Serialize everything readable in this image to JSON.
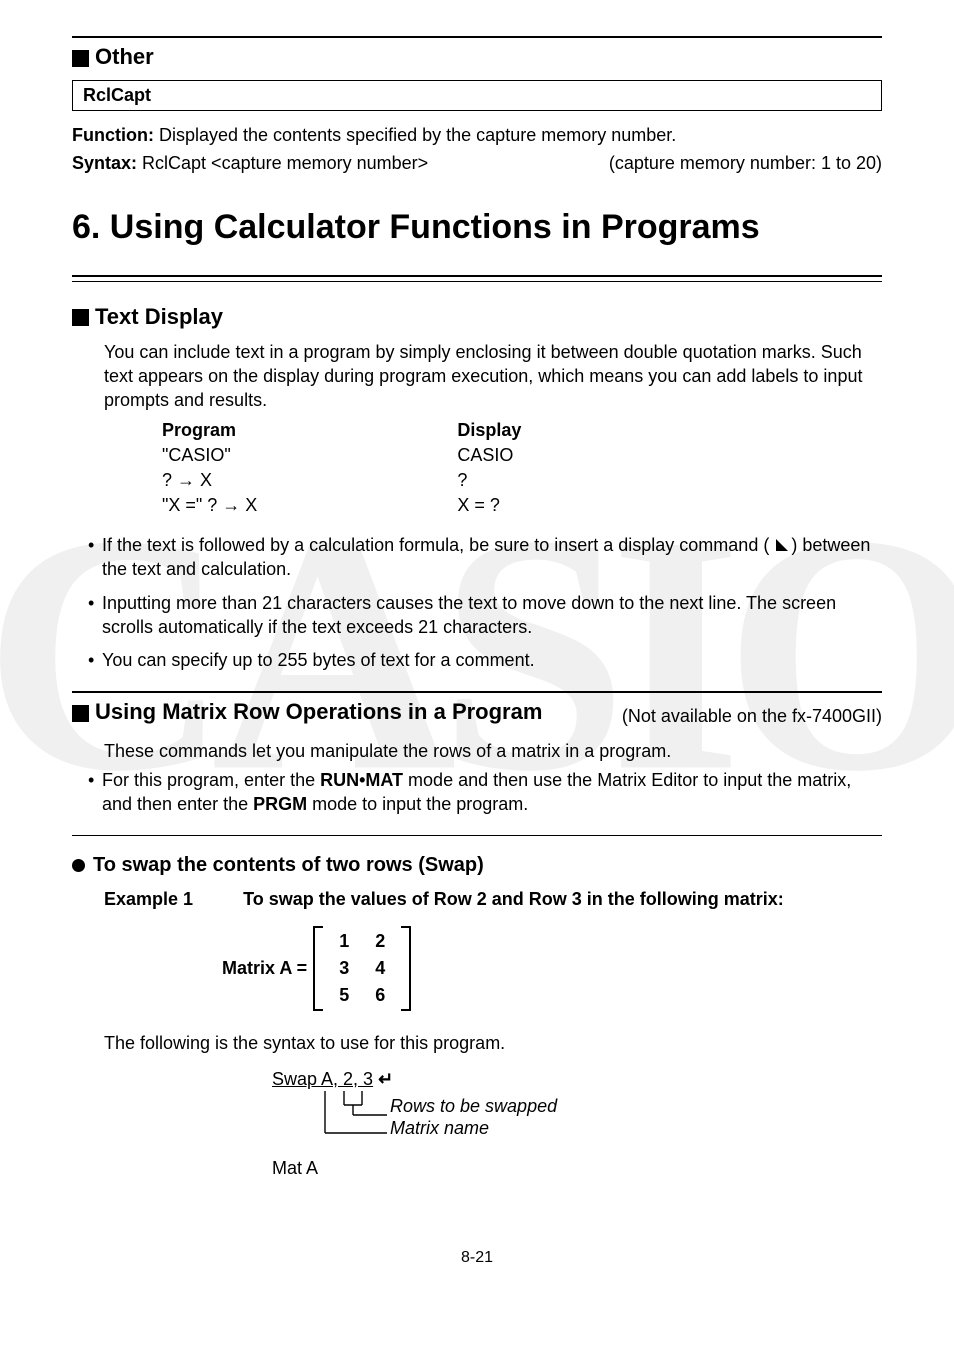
{
  "watermark": "CASIO",
  "sec1": {
    "title": "Other"
  },
  "cmdbox": {
    "name": "RclCapt"
  },
  "func": {
    "label": "Function:",
    "text": " Displayed the contents specified by the capture memory number."
  },
  "syntax": {
    "label": "Syntax:",
    "text": " RclCapt <capture memory number>",
    "right": "(capture memory number: 1 to 20)"
  },
  "bigtitle": "6. Using Calculator Functions in Programs",
  "sec2": {
    "title": "Text Display",
    "intro": "You can include text in a program by simply enclosing it between double quotation marks. Such text appears on the display during program execution, which means you can add labels to input prompts and results.",
    "table": {
      "h1": "Program",
      "h2": "Display",
      "r1c1": "\"CASIO\"",
      "r1c2": "CASIO",
      "r2c1": "? → X",
      "r2c2": "?",
      "r3c1": "\"X =\" ? → X",
      "r3c2": "X = ?"
    },
    "b1a": "If the text is followed by a calculation formula, be sure to insert a display command ( ",
    "b1b": " ) between the text and calculation.",
    "b2": "Inputting more than 21 characters causes the text to move down to the next line. The screen scrolls automatically if the text exceeds 21 characters.",
    "b3": "You can specify up to 255 bytes of text for a comment."
  },
  "sec3": {
    "title": "Using Matrix Row Operations in a Program",
    "note": "(Not available on the fx-7400GII)",
    "p1": "These commands let you manipulate the rows of a matrix in a program.",
    "b1a": "For this program, enter the ",
    "b1b": "RUN•MAT",
    "b1c": " mode and then use the Matrix Editor to input the matrix, and then enter the ",
    "b1d": "PRGM",
    "b1e": " mode to input the program."
  },
  "swap": {
    "head": "To swap the contents of two rows (Swap)",
    "ex_label": "Example 1",
    "ex_text": "To swap the values of Row 2 and Row 3 in the following matrix:",
    "matrix_label": "Matrix A =",
    "m": {
      "r1c1": "1",
      "r1c2": "2",
      "r2c1": "3",
      "r2c2": "4",
      "r3c1": "5",
      "r3c2": "6"
    },
    "syntax_line": "The following is the syntax to use for this program.",
    "swap_cmd": "Swap A, 2, 3",
    "ret": "↵",
    "lbl_rows": "Rows to be swapped",
    "lbl_name": "Matrix name",
    "mat_a": "Mat A"
  },
  "pagenum": "8-21"
}
